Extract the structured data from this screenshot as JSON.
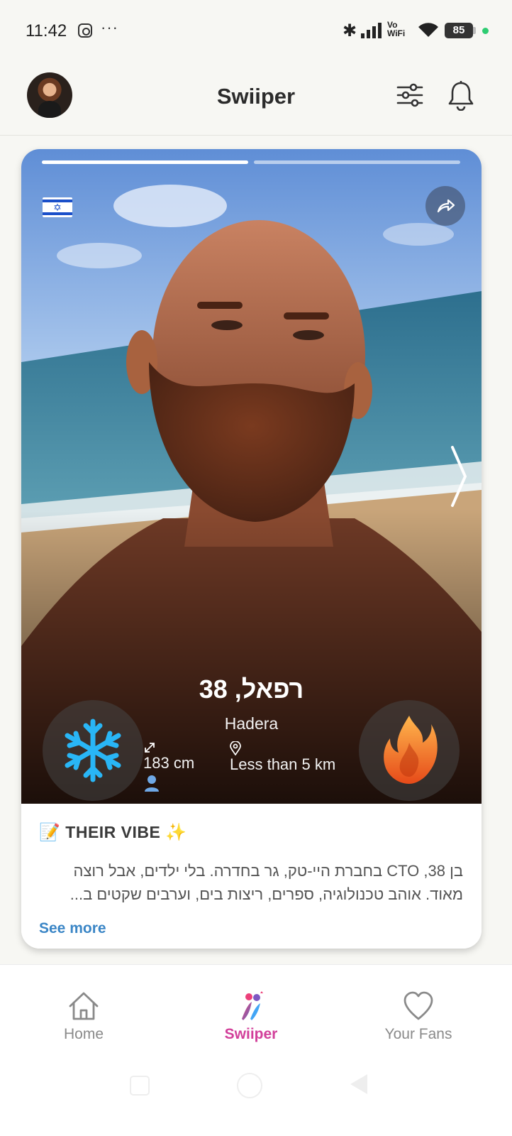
{
  "status_bar": {
    "time": "11:42",
    "more": "···",
    "network_label_top": "Vo",
    "network_label_bottom": "WiFi",
    "battery": "85",
    "icons": [
      "instagram-icon",
      "bluetooth-icon",
      "signal-icon",
      "wifi-icon",
      "battery-icon"
    ]
  },
  "header": {
    "title": "Swiiper",
    "icons": [
      "avatar",
      "filter-icon",
      "bell-icon"
    ]
  },
  "profile": {
    "name_age": "רפאל, 38",
    "city": "Hadera",
    "height": "183 cm",
    "distance": "Less than 5 km",
    "flag": "israel-flag",
    "photos_total": 2,
    "photo_current": 1
  },
  "vibe": {
    "emoji": "📝",
    "title": "THEIR VIBE",
    "sparkle": "✨",
    "text": "בן 38, CTO בחברת היי-טק, גר בחדרה. בלי ילדים, אבל רוצה מאוד. אוהב טכנולוגיה, ספרים, ריצות בים, וערבים שקטים ב...",
    "see_more": "See more"
  },
  "nav": {
    "home": "Home",
    "swiper": "Swiiper",
    "fans": "Your Fans"
  },
  "colors": {
    "accent": "#d23f9a",
    "link": "#3b86c6",
    "pass": "#29b6f6",
    "like": "#f4511e"
  }
}
